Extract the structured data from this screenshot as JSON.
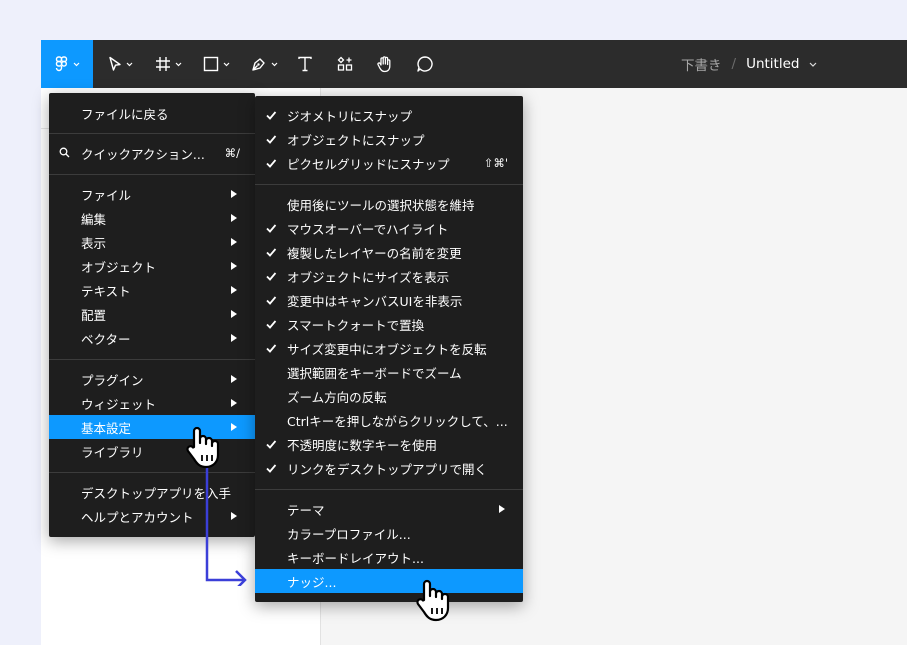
{
  "toolbar": {
    "tools": [
      {
        "name": "main-menu",
        "icon": "figma-logo-icon"
      },
      {
        "name": "move-tool",
        "icon": "pointer-icon"
      },
      {
        "name": "frame-tool",
        "icon": "frame-hash-icon"
      },
      {
        "name": "shape-tool",
        "icon": "rectangle-icon"
      },
      {
        "name": "pen-tool",
        "icon": "pen-icon"
      },
      {
        "name": "text-tool",
        "icon": "text-icon"
      },
      {
        "name": "resources-tool",
        "icon": "resources-icon"
      },
      {
        "name": "hand-tool",
        "icon": "hand-icon"
      },
      {
        "name": "comment-tool",
        "icon": "comment-icon"
      }
    ],
    "breadcrumb_draft": "下書き",
    "breadcrumb_sep": "/",
    "file_name": "Untitled"
  },
  "main_menu": {
    "back_to_files": "ファイルに戻る",
    "quick_actions": "クイックアクション...",
    "quick_actions_shortcut": "⌘/",
    "file": "ファイル",
    "edit": "編集",
    "view": "表示",
    "object": "オブジェクト",
    "text": "テキスト",
    "arrange": "配置",
    "vector": "ベクター",
    "plugins": "プラグイン",
    "widgets": "ウィジェット",
    "preferences": "基本設定",
    "libraries": "ライブラリ",
    "desktop_app": "デスクトップアプリを入手",
    "help_account": "ヘルプとアカウント"
  },
  "sub_menu": {
    "snap_geometry": "ジオメトリにスナップ",
    "snap_objects": "オブジェクトにスナップ",
    "snap_pixel_grid": "ピクセルグリッドにスナップ",
    "snap_pixel_grid_shortcut": "⇧⌘'",
    "keep_tool_selected": "使用後にツールの選択状態を維持",
    "highlight_on_hover": "マウスオーバーでハイライト",
    "rename_duplicated": "複製したレイヤーの名前を変更",
    "show_dimensions": "オブジェクトにサイズを表示",
    "hide_canvas_ui": "変更中はキャンバスUIを非表示",
    "smart_quotes": "スマートクォートで置換",
    "flip_on_resize": "サイズ変更中にオブジェクトを反転",
    "zoom_to_selection": "選択範囲をキーボードでズーム",
    "invert_zoom": "ズーム方向の反転",
    "ctrl_click": "Ctrlキーを押しながらクリックして、...",
    "opacity_keys": "不透明度に数字キーを使用",
    "open_links_desktop": "リンクをデスクトップアプリで開く",
    "theme": "テーマ",
    "color_profile": "カラープロファイル...",
    "keyboard_layout": "キーボードレイアウト...",
    "nudge": "ナッジ..."
  },
  "colors": {
    "accent": "#0d99ff",
    "menu_bg": "#1e1e1e",
    "toolbar_bg": "#2c2c2c",
    "annotation_arrow": "#3b3fd8"
  }
}
